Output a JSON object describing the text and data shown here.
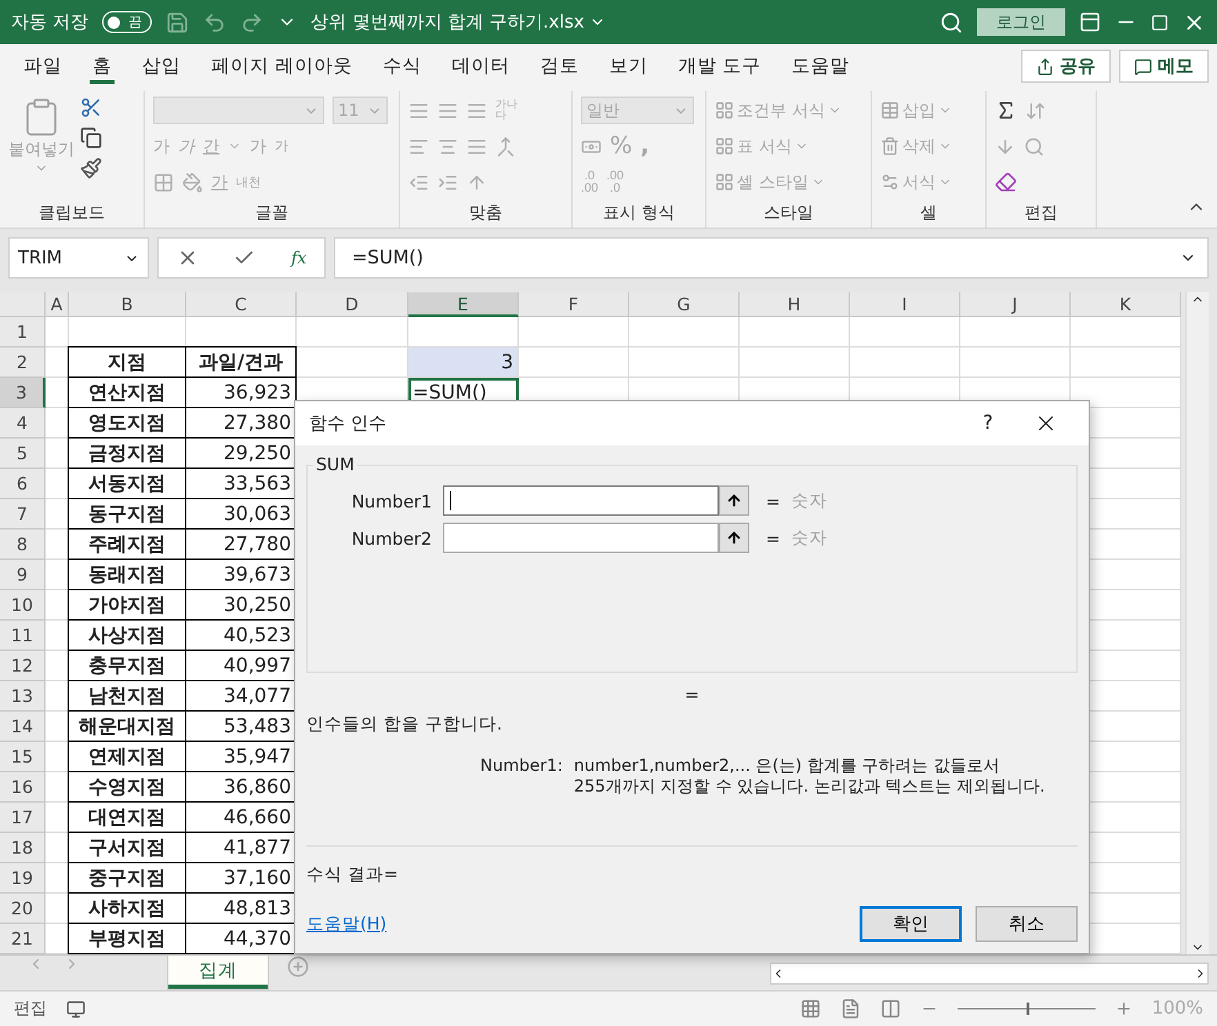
{
  "title_bar": {
    "autosave_label": "자동 저장",
    "autosave_state": "끔",
    "autosave_on": false,
    "file_name": "상위 몇번째까지 합계 구하기.xlsx",
    "sign_in": "로그인"
  },
  "menu_tabs": [
    {
      "label": "파일",
      "selected": false
    },
    {
      "label": "홈",
      "selected": true
    },
    {
      "label": "삽입",
      "selected": false
    },
    {
      "label": "페이지 레이아웃",
      "selected": false
    },
    {
      "label": "수식",
      "selected": false
    },
    {
      "label": "데이터",
      "selected": false
    },
    {
      "label": "검토",
      "selected": false
    },
    {
      "label": "보기",
      "selected": false
    },
    {
      "label": "개발 도구",
      "selected": false
    },
    {
      "label": "도움말",
      "selected": false
    }
  ],
  "share": "공유",
  "comments": "메모",
  "ribbon": {
    "clipboard": {
      "label": "클립보드",
      "paste": "붙여넣기",
      "paste_disabled": true
    },
    "font": {
      "label": "글꼴",
      "disabled": true,
      "size": "11",
      "bold": "가",
      "italic": "가",
      "underline": "간",
      "grow": "가",
      "shrink": "가",
      "font_color": "가",
      "phonetic": "내천"
    },
    "alignment": {
      "label": "맞춤",
      "disabled": true,
      "wrap": "가나다"
    },
    "number": {
      "label": "표시 형식",
      "disabled": true,
      "format": "일반",
      "percent": "%",
      "comma": ",",
      "decimals": [
        {
          "top": ".0",
          "bottom": ".00"
        },
        {
          "top": ".00",
          "bottom": ".0"
        }
      ]
    },
    "styles": {
      "label": "스타일",
      "disabled": true,
      "items": [
        "조건부 서식",
        "표 서식",
        "셀 스타일"
      ]
    },
    "cells": {
      "label": "셀",
      "disabled": true,
      "items": [
        "삽입",
        "삭제",
        "서식"
      ]
    },
    "editing": {
      "label": "편집"
    }
  },
  "formula_bar": {
    "name_box": "TRIM",
    "fx": "fx",
    "formula": "=SUM()"
  },
  "sheet": {
    "columns": [
      {
        "label": "A",
        "selected": false
      },
      {
        "label": "B",
        "selected": false
      },
      {
        "label": "C",
        "selected": false
      },
      {
        "label": "D",
        "selected": false
      },
      {
        "label": "E",
        "selected": true
      },
      {
        "label": "F",
        "selected": false
      },
      {
        "label": "G",
        "selected": false
      },
      {
        "label": "H",
        "selected": false
      },
      {
        "label": "I",
        "selected": false
      },
      {
        "label": "J",
        "selected": false
      },
      {
        "label": "K",
        "selected": false
      }
    ],
    "rows": [
      {
        "number": "1",
        "selected": false
      },
      {
        "number": "2",
        "selected": false,
        "b": "지점",
        "c": "과일/견과",
        "e": "3",
        "e_highlighted": true,
        "header": true
      },
      {
        "number": "3",
        "selected": true,
        "b": "연산지점",
        "c": "36,923",
        "e": "=SUM()",
        "e_active": true
      },
      {
        "number": "4",
        "selected": false,
        "b": "영도지점",
        "c": "27,380"
      },
      {
        "number": "5",
        "selected": false,
        "b": "금정지점",
        "c": "29,250"
      },
      {
        "number": "6",
        "selected": false,
        "b": "서동지점",
        "c": "33,563"
      },
      {
        "number": "7",
        "selected": false,
        "b": "동구지점",
        "c": "30,063"
      },
      {
        "number": "8",
        "selected": false,
        "b": "주례지점",
        "c": "27,780"
      },
      {
        "number": "9",
        "selected": false,
        "b": "동래지점",
        "c": "39,673"
      },
      {
        "number": "10",
        "selected": false,
        "b": "가야지점",
        "c": "30,250"
      },
      {
        "number": "11",
        "selected": false,
        "b": "사상지점",
        "c": "40,523"
      },
      {
        "number": "12",
        "selected": false,
        "b": "충무지점",
        "c": "40,997"
      },
      {
        "number": "13",
        "selected": false,
        "b": "남천지점",
        "c": "34,077"
      },
      {
        "number": "14",
        "selected": false,
        "b": "해운대지점",
        "c": "53,483"
      },
      {
        "number": "15",
        "selected": false,
        "b": "연제지점",
        "c": "35,947"
      },
      {
        "number": "16",
        "selected": false,
        "b": "수영지점",
        "c": "36,860"
      },
      {
        "number": "17",
        "selected": false,
        "b": "대연지점",
        "c": "46,660"
      },
      {
        "number": "18",
        "selected": false,
        "b": "구서지점",
        "c": "41,877"
      },
      {
        "number": "19",
        "selected": false,
        "b": "중구지점",
        "c": "37,160"
      },
      {
        "number": "20",
        "selected": false,
        "b": "사하지점",
        "c": "48,813"
      },
      {
        "number": "21",
        "selected": false,
        "b": "부평지점",
        "c": "44,370"
      }
    ]
  },
  "dialog": {
    "title": "함수 인수",
    "help": "?",
    "function_name": "SUM",
    "arguments": [
      {
        "name": "Number1",
        "equals": "=",
        "result": "숫자",
        "focused": true
      },
      {
        "name": "Number2",
        "equals": "=",
        "result": "숫자",
        "focused": false
      }
    ],
    "result_equals": "=",
    "description": "인수들의 합을 구합니다.",
    "argument_label": "Number1:",
    "argument_help": "number1,number2,... 은(는) 합계를 구하려는 값들로서 255개까지 지정할 수 있습니다. 논리값과 텍스트는 제외됩니다.",
    "formula_result": "수식 결과=",
    "help_link": "도움말(H)",
    "buttons": [
      {
        "label": "확인",
        "default": true
      },
      {
        "label": "취소",
        "default": false
      }
    ]
  },
  "sheet_tabs": [
    {
      "label": "집계",
      "selected": true
    }
  ],
  "status_bar": {
    "mode": "편집",
    "zoom": "100%",
    "zoom_slider": {
      "level": 0.5
    }
  }
}
